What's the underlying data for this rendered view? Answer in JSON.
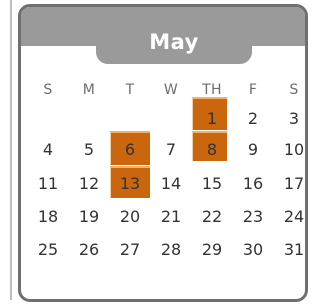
{
  "calendar": {
    "month": "May",
    "weekdays": [
      "S",
      "M",
      "T",
      "W",
      "TH",
      "F",
      "S"
    ],
    "days": [
      [
        "",
        "",
        "",
        "",
        "1",
        "2",
        "3"
      ],
      [
        "4",
        "5",
        "6",
        "7",
        "8",
        "9",
        "10"
      ],
      [
        "11",
        "12",
        "13",
        "14",
        "15",
        "16",
        "17"
      ],
      [
        "18",
        "19",
        "20",
        "21",
        "22",
        "23",
        "24"
      ],
      [
        "25",
        "26",
        "27",
        "28",
        "29",
        "30",
        "31"
      ]
    ],
    "highlighted_days": [
      "1",
      "6",
      "8",
      "13"
    ],
    "accent_color": "#c9660e"
  }
}
